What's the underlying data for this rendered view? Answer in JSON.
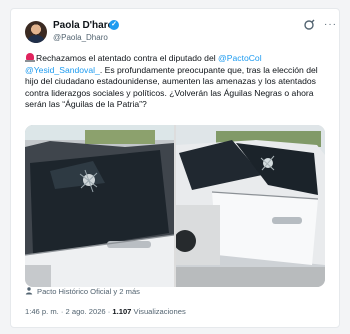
{
  "author": {
    "name": "Paola D'haro",
    "handle": "@Paola_Dharo"
  },
  "tweet": {
    "part1": "Rechazamos el atentado contra el diputado del ",
    "mention1": "@PactoCol",
    "space": " ",
    "mention2": "@Yesid_Sandoval_",
    "part2": ". Es profundamente preocupante que, tras la elección del hijo del ciudadano estadounidense, aumenten las amenazas y los atentados contra liderazgos sociales y políticos. ¿Volverán las Águilas Negras o ahora serán las “Águilas de la Patria”?"
  },
  "tags": "Pacto Histórico Oficial y 2 más",
  "meta": {
    "time": "1:46 p. m.",
    "sep1": " · ",
    "date": "2 ago. 2026",
    "sep2": " · ",
    "views_count": "1.107",
    "views_label": " Visualizaciones"
  },
  "colors": {
    "accent": "#1d9bf0",
    "alert": "#e0245e",
    "muted": "#536471"
  },
  "icons": [
    "verified-badge-icon",
    "grok-icon",
    "more-icon",
    "police-light-icon",
    "person-icon"
  ]
}
